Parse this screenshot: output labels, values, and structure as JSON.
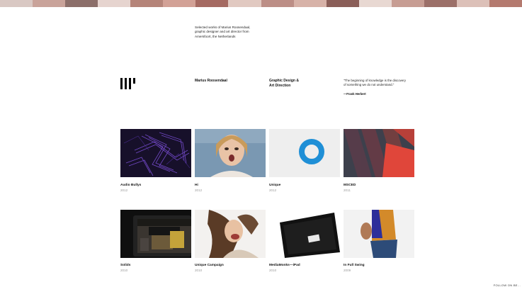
{
  "colors": {
    "strip": [
      "#d9c8c3",
      "#c9a39a",
      "#8c6f6a",
      "#e6d4cf",
      "#b58479",
      "#d2a196",
      "#a56a62",
      "#e1c9c1",
      "#bc8e86",
      "#d7b2a8",
      "#8a5e58",
      "#e8d8d2",
      "#c79d93",
      "#9c7069",
      "#dcc0b8",
      "#b47a6f"
    ]
  },
  "intro": {
    "line1": "Selected works of Marius Roosendaal,",
    "line2": "graphic designer and art director from",
    "line3": "Amersfoort, the Netherlands"
  },
  "header": {
    "logo_icon": "logo-mark-icon",
    "name": "Marius Roosendaal",
    "discipline_line1": "Graphic Design &",
    "discipline_line2": "Art Direction",
    "quote_line1": "\"The beginning of knowledge is the discovery",
    "quote_line2": "of something we do not understand.\"",
    "quote_author": "—Frank Herbert"
  },
  "projects": [
    {
      "title": "Audio Bullys",
      "year": "2012"
    },
    {
      "title": "Hi",
      "year": "2012"
    },
    {
      "title": "Unique",
      "year": "2012"
    },
    {
      "title": "MSCED",
      "year": "2011"
    },
    {
      "title": "Solids",
      "year": "2010"
    },
    {
      "title": "Unique Campaign",
      "year": "2010"
    },
    {
      "title": "MediaMonks—iPad",
      "year": "2010"
    },
    {
      "title": "In Full Swing",
      "year": "2009"
    }
  ],
  "footer": {
    "follow": "FOLLOW ON BE..."
  }
}
